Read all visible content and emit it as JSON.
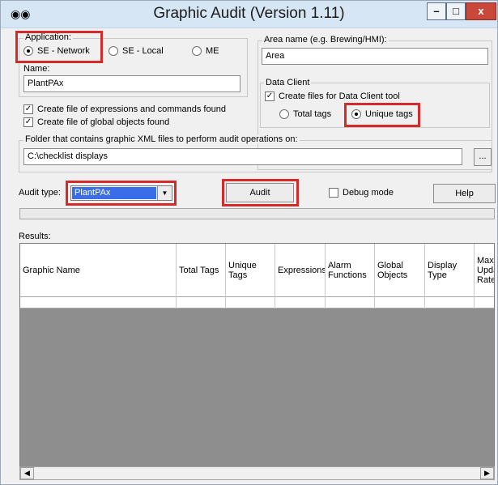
{
  "window": {
    "title": "Graphic Audit (Version 1.11)"
  },
  "application": {
    "label": "Application:",
    "options": [
      "SE - Network",
      "SE - Local",
      "ME"
    ],
    "selected": "SE - Network",
    "name_label": "Name:",
    "name_value": "PlantPAx"
  },
  "area": {
    "label": "Area name (e.g. Brewing/HMI):",
    "value": "Area"
  },
  "data_client": {
    "label": "Data Client",
    "create_files": "Create files for Data Client tool",
    "options": [
      "Total tags",
      "Unique tags"
    ],
    "selected": "Unique tags"
  },
  "checks": {
    "expressions": "Create file of expressions and commands found",
    "global_objects": "Create file of global objects found"
  },
  "folder": {
    "label": "Folder that contains graphic XML files to perform audit operations on:",
    "value": "C:\\checklist displays",
    "browse": "..."
  },
  "audit": {
    "type_label": "Audit type:",
    "type_value": "PlantPAx",
    "audit_button": "Audit",
    "debug_label": "Debug mode",
    "help_button": "Help"
  },
  "results": {
    "label": "Results:",
    "columns": [
      "Graphic Name",
      "Total Tags",
      "Unique Tags",
      "Expressions",
      "Alarm Functions",
      "Global Objects",
      "Display Type",
      "Max Update Rate"
    ]
  },
  "icons": {
    "app": "binoculars-icon",
    "minimize": "minimize-icon",
    "maximize": "maximize-icon",
    "close": "close-icon",
    "dropdown": "chevron-down-icon",
    "scroll_left": "arrow-left-icon",
    "scroll_right": "arrow-right-icon"
  },
  "colors": {
    "highlight": "#d42a2a",
    "selection": "#3a6ee8",
    "grid_background": "#8e8e8e",
    "titlebar": "#d6e6f5"
  }
}
